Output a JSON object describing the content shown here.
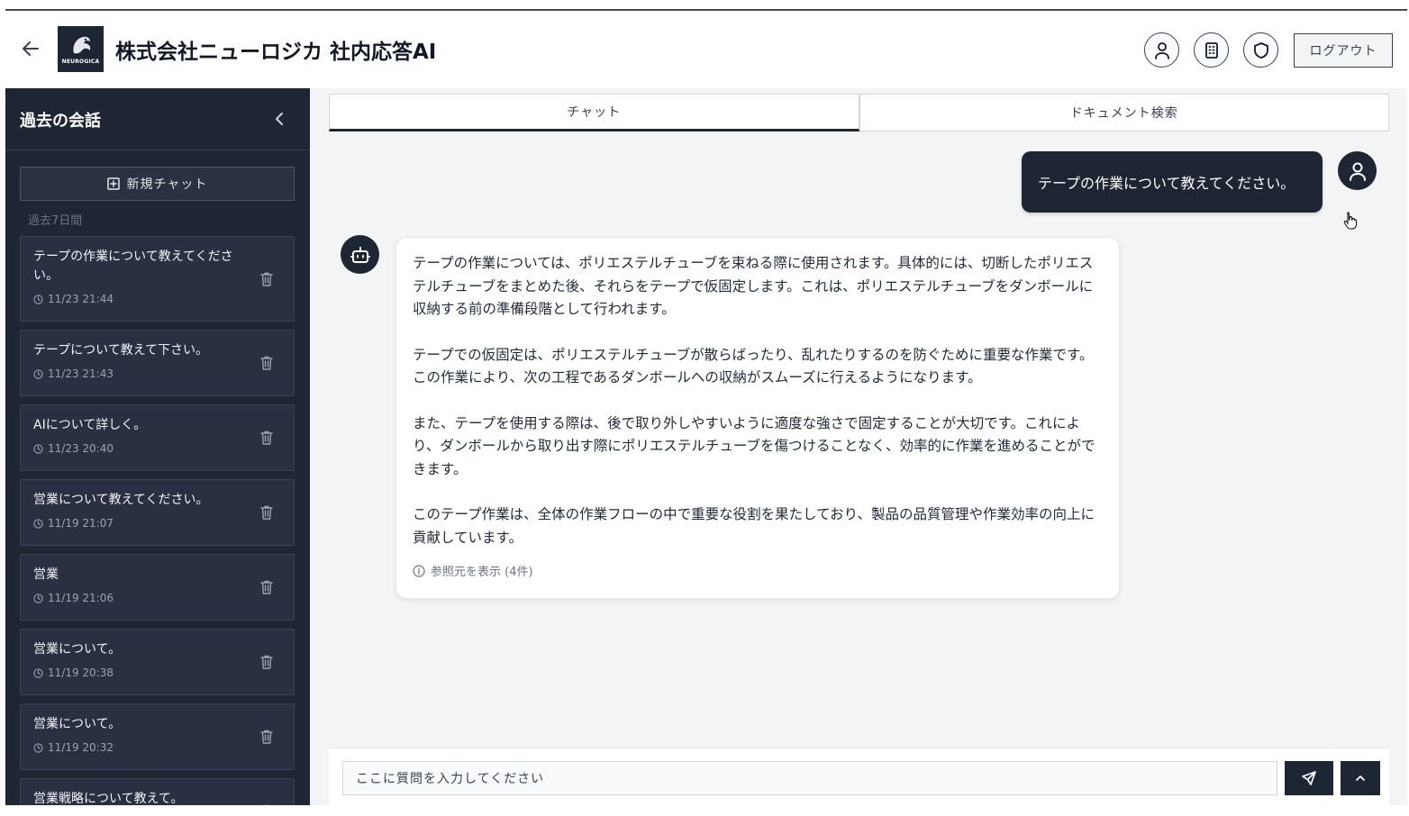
{
  "header": {
    "title": "株式会社ニューロジカ 社内応答AI",
    "logo_text": "NEUROGICA",
    "logout_label": "ログアウト",
    "icons": [
      "user-icon",
      "building-icon",
      "shield-icon"
    ]
  },
  "sidebar": {
    "title": "過去の会話",
    "new_chat_label": "新規チャット",
    "section_label": "過去7日間",
    "conversations": [
      {
        "title": "テープの作業について教えてください。",
        "time": "11/23 21:44"
      },
      {
        "title": "テープについて教えて下さい。",
        "time": "11/23 21:43"
      },
      {
        "title": "AIについて詳しく。",
        "time": "11/23 20:40"
      },
      {
        "title": "営業について教えてください。",
        "time": "11/19 21:07"
      },
      {
        "title": "営業",
        "time": "11/19 21:06"
      },
      {
        "title": "営業について。",
        "time": "11/19 20:38"
      },
      {
        "title": "営業について。",
        "time": "11/19 20:32"
      },
      {
        "title": "営業戦略について教えて。",
        "time": ""
      }
    ]
  },
  "tabs": [
    {
      "label": "チャット",
      "active": true
    },
    {
      "label": "ドキュメント検索",
      "active": false
    }
  ],
  "chat": {
    "user_message": "テープの作業について教えてください。",
    "bot_paragraphs": [
      "テープの作業については、ポリエステルチューブを束ねる際に使用されます。具体的には、切断したポリエステルチューブをまとめた後、それらをテープで仮固定します。これは、ポリエステルチューブをダンボールに収納する前の準備段階として行われます。",
      "テープでの仮固定は、ポリエステルチューブが散らばったり、乱れたりするのを防ぐために重要な作業です。この作業により、次の工程であるダンボールへの収納がスムーズに行えるようになります。",
      "また、テープを使用する際は、後で取り外しやすいように適度な強さで固定することが大切です。これにより、ダンボールから取り出す際にポリエステルチューブを傷つけることなく、効率的に作業を進めることができます。",
      "このテープ作業は、全体の作業フローの中で重要な役割を果たしており、製品の品質管理や作業効率の向上に貢献しています。"
    ],
    "refs_label": "参照元を表示 (4件)"
  },
  "input": {
    "placeholder": "ここに質問を入力してください"
  },
  "colors": {
    "dark": "#1e2533",
    "sidebar_item": "#283041"
  }
}
